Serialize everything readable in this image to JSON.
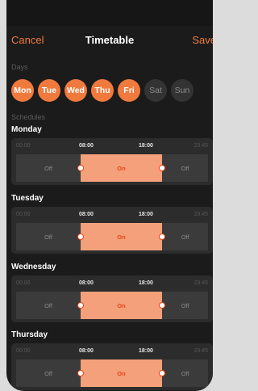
{
  "nav": {
    "cancel": "Cancel",
    "title": "Timetable",
    "save": "Save"
  },
  "days_label": "Days",
  "days": [
    {
      "label": "Mon",
      "active": true
    },
    {
      "label": "Tue",
      "active": true
    },
    {
      "label": "Wed",
      "active": true
    },
    {
      "label": "Thu",
      "active": true
    },
    {
      "label": "Fri",
      "active": true
    },
    {
      "label": "Sat",
      "active": false
    },
    {
      "label": "Sun",
      "active": false
    }
  ],
  "schedules_label": "Schedules",
  "timeline": {
    "start": "00:00",
    "on_from": "08:00",
    "on_to": "18:00",
    "end": "23:45"
  },
  "segment_labels": {
    "off_before": "Off",
    "on": "On",
    "off_after": "Off"
  },
  "schedules": [
    {
      "day": "Monday"
    },
    {
      "day": "Tuesday"
    },
    {
      "day": "Wednesday"
    },
    {
      "day": "Thursday"
    }
  ],
  "colors": {
    "accent": "#f07a3e",
    "on_fill": "#f4a07a",
    "on_text": "#e8461a",
    "background": "#1b1b1b"
  }
}
